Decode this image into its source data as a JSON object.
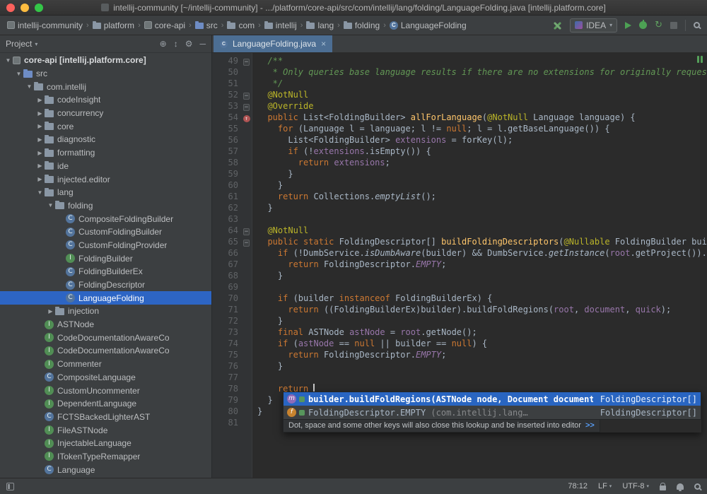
{
  "window": {
    "title": "intellij-community [~/intellij-community] - .../platform/core-api/src/com/intellij/lang/folding/LanguageFolding.java [intellij.platform.core]"
  },
  "navbar": {
    "crumbs": [
      {
        "label": "intellij-community",
        "icon": "project"
      },
      {
        "label": "platform",
        "icon": "folder"
      },
      {
        "label": "core-api",
        "icon": "module"
      },
      {
        "label": "src",
        "icon": "folder-src"
      },
      {
        "label": "com",
        "icon": "package"
      },
      {
        "label": "intellij",
        "icon": "package"
      },
      {
        "label": "lang",
        "icon": "package"
      },
      {
        "label": "folding",
        "icon": "package"
      },
      {
        "label": "LanguageFolding",
        "icon": "class"
      }
    ],
    "run_config": "IDEA"
  },
  "project_panel": {
    "title": "Project",
    "tree": [
      {
        "depth": 0,
        "label": "core-api [intellij.platform.core]",
        "icon": "module",
        "expand": "open",
        "bold": true
      },
      {
        "depth": 1,
        "label": "src",
        "icon": "folder-src",
        "expand": "open"
      },
      {
        "depth": 2,
        "label": "com.intellij",
        "icon": "package",
        "expand": "open"
      },
      {
        "depth": 3,
        "label": "codeInsight",
        "icon": "package",
        "expand": "closed"
      },
      {
        "depth": 3,
        "label": "concurrency",
        "icon": "package",
        "expand": "closed"
      },
      {
        "depth": 3,
        "label": "core",
        "icon": "package",
        "expand": "closed"
      },
      {
        "depth": 3,
        "label": "diagnostic",
        "icon": "package",
        "expand": "closed"
      },
      {
        "depth": 3,
        "label": "formatting",
        "icon": "package",
        "expand": "closed"
      },
      {
        "depth": 3,
        "label": "ide",
        "icon": "package",
        "expand": "closed"
      },
      {
        "depth": 3,
        "label": "injected.editor",
        "icon": "package",
        "expand": "closed"
      },
      {
        "depth": 3,
        "label": "lang",
        "icon": "package",
        "expand": "open"
      },
      {
        "depth": 4,
        "label": "folding",
        "icon": "package",
        "expand": "open"
      },
      {
        "depth": 5,
        "label": "CompositeFoldingBuilder",
        "icon": "class"
      },
      {
        "depth": 5,
        "label": "CustomFoldingBuilder",
        "icon": "class"
      },
      {
        "depth": 5,
        "label": "CustomFoldingProvider",
        "icon": "class"
      },
      {
        "depth": 5,
        "label": "FoldingBuilder",
        "icon": "interface"
      },
      {
        "depth": 5,
        "label": "FoldingBuilderEx",
        "icon": "class"
      },
      {
        "depth": 5,
        "label": "FoldingDescriptor",
        "icon": "class"
      },
      {
        "depth": 5,
        "label": "LanguageFolding",
        "icon": "class",
        "selected": true
      },
      {
        "depth": 4,
        "label": "injection",
        "icon": "package",
        "expand": "closed"
      },
      {
        "depth": 3,
        "label": "ASTNode",
        "icon": "interface"
      },
      {
        "depth": 3,
        "label": "CodeDocumentationAwareCo",
        "icon": "interface"
      },
      {
        "depth": 3,
        "label": "CodeDocumentationAwareCo",
        "icon": "interface"
      },
      {
        "depth": 3,
        "label": "Commenter",
        "icon": "interface"
      },
      {
        "depth": 3,
        "label": "CompositeLanguage",
        "icon": "class"
      },
      {
        "depth": 3,
        "label": "CustomUncommenter",
        "icon": "interface"
      },
      {
        "depth": 3,
        "label": "DependentLanguage",
        "icon": "interface"
      },
      {
        "depth": 3,
        "label": "FCTSBackedLighterAST",
        "icon": "class"
      },
      {
        "depth": 3,
        "label": "FileASTNode",
        "icon": "interface"
      },
      {
        "depth": 3,
        "label": "InjectableLanguage",
        "icon": "interface"
      },
      {
        "depth": 3,
        "label": "ITokenTypeRemapper",
        "icon": "interface"
      },
      {
        "depth": 3,
        "label": "Language",
        "icon": "class"
      }
    ]
  },
  "editor_tabs": [
    {
      "label": "LanguageFolding.java",
      "close": "×"
    }
  ],
  "editor": {
    "lines": [
      {
        "n": 49,
        "fold": "minus",
        "seg": [
          [
            "  /**",
            "c"
          ]
        ]
      },
      {
        "n": 50,
        "seg": [
          [
            "   * Only queries base language results if there are no extensions for originally requested",
            "c"
          ]
        ]
      },
      {
        "n": 51,
        "seg": [
          [
            "   */",
            "c"
          ]
        ]
      },
      {
        "n": 52,
        "fold": "minus",
        "seg": [
          [
            "  ",
            "d"
          ],
          [
            "@NotNull",
            "a"
          ]
        ]
      },
      {
        "n": 53,
        "fold": "minus",
        "seg": [
          [
            "  ",
            "d"
          ],
          [
            "@Override",
            "a"
          ]
        ]
      },
      {
        "n": 54,
        "gutter": "override",
        "seg": [
          [
            "  ",
            "d"
          ],
          [
            "public ",
            "k"
          ],
          [
            "List<FoldingBuilder> ",
            "d"
          ],
          [
            "allForLanguage",
            "m"
          ],
          [
            "(",
            "d"
          ],
          [
            "@NotNull",
            "a"
          ],
          [
            " Language language) {",
            "d"
          ]
        ]
      },
      {
        "n": 55,
        "seg": [
          [
            "    ",
            "d"
          ],
          [
            "for",
            "k"
          ],
          [
            " (Language l = language; l != ",
            "d"
          ],
          [
            "null",
            "k"
          ],
          [
            "; l = l.getBaseLanguage()) {",
            "d"
          ]
        ]
      },
      {
        "n": 56,
        "seg": [
          [
            "      List<FoldingBuilder> ",
            "d"
          ],
          [
            "extensions",
            "f"
          ],
          [
            " = forKey(l);",
            "d"
          ]
        ]
      },
      {
        "n": 57,
        "seg": [
          [
            "      ",
            "d"
          ],
          [
            "if",
            "k"
          ],
          [
            " (!",
            "d"
          ],
          [
            "extensions",
            "f"
          ],
          [
            ".isEmpty()) {",
            "d"
          ]
        ]
      },
      {
        "n": 58,
        "seg": [
          [
            "        ",
            "d"
          ],
          [
            "return ",
            "k"
          ],
          [
            "extensions",
            "f"
          ],
          [
            ";",
            "d"
          ]
        ]
      },
      {
        "n": 59,
        "seg": [
          [
            "      }",
            "d"
          ]
        ]
      },
      {
        "n": 60,
        "seg": [
          [
            "    }",
            "d"
          ]
        ]
      },
      {
        "n": 61,
        "seg": [
          [
            "    ",
            "d"
          ],
          [
            "return ",
            "k"
          ],
          [
            "Collections.",
            "d"
          ],
          [
            "emptyList",
            "si"
          ],
          [
            "();",
            "d"
          ]
        ]
      },
      {
        "n": 62,
        "seg": [
          [
            "  }",
            "d"
          ]
        ]
      },
      {
        "n": 63,
        "seg": []
      },
      {
        "n": 64,
        "fold": "minus",
        "seg": [
          [
            "  ",
            "d"
          ],
          [
            "@NotNull",
            "a"
          ]
        ]
      },
      {
        "n": 65,
        "fold": "minus",
        "seg": [
          [
            "  ",
            "d"
          ],
          [
            "public static ",
            "k"
          ],
          [
            "FoldingDescriptor[] ",
            "d"
          ],
          [
            "buildFoldingDescriptors",
            "m"
          ],
          [
            "(",
            "d"
          ],
          [
            "@Nullable",
            "a"
          ],
          [
            " FoldingBuilder builder",
            "d"
          ]
        ]
      },
      {
        "n": 66,
        "seg": [
          [
            "    ",
            "d"
          ],
          [
            "if",
            "k"
          ],
          [
            " (!DumbService.",
            "d"
          ],
          [
            "isDumbAware",
            "si"
          ],
          [
            "(builder) && DumbService.",
            "d"
          ],
          [
            "getInstance",
            "si"
          ],
          [
            "(",
            "d"
          ],
          [
            "root",
            "f"
          ],
          [
            ".getProject()).isDum",
            "d"
          ]
        ]
      },
      {
        "n": 67,
        "seg": [
          [
            "      ",
            "d"
          ],
          [
            "return ",
            "k"
          ],
          [
            "FoldingDescriptor.",
            "d"
          ],
          [
            "EMPTY",
            "sf"
          ],
          [
            ";",
            "d"
          ]
        ]
      },
      {
        "n": 68,
        "seg": [
          [
            "    }",
            "d"
          ]
        ]
      },
      {
        "n": 69,
        "seg": []
      },
      {
        "n": 70,
        "seg": [
          [
            "    ",
            "d"
          ],
          [
            "if",
            "k"
          ],
          [
            " (builder ",
            "d"
          ],
          [
            "instanceof",
            "k"
          ],
          [
            " FoldingBuilderEx) {",
            "d"
          ]
        ]
      },
      {
        "n": 71,
        "seg": [
          [
            "      ",
            "d"
          ],
          [
            "return ",
            "k"
          ],
          [
            "((FoldingBuilderEx)builder).buildFoldRegions(",
            "d"
          ],
          [
            "root",
            "f"
          ],
          [
            ", ",
            "d"
          ],
          [
            "document",
            "f"
          ],
          [
            ", ",
            "d"
          ],
          [
            "quick",
            "f"
          ],
          [
            ");",
            "d"
          ]
        ]
      },
      {
        "n": 72,
        "seg": [
          [
            "    }",
            "d"
          ]
        ]
      },
      {
        "n": 73,
        "seg": [
          [
            "    ",
            "d"
          ],
          [
            "final ",
            "k"
          ],
          [
            "ASTNode ",
            "d"
          ],
          [
            "astNode",
            "f"
          ],
          [
            " = ",
            "d"
          ],
          [
            "root",
            "f"
          ],
          [
            ".getNode();",
            "d"
          ]
        ]
      },
      {
        "n": 74,
        "seg": [
          [
            "    ",
            "d"
          ],
          [
            "if",
            "k"
          ],
          [
            " (",
            "d"
          ],
          [
            "astNode",
            "f"
          ],
          [
            " == ",
            "d"
          ],
          [
            "null",
            "k"
          ],
          [
            " || builder == ",
            "d"
          ],
          [
            "null",
            "k"
          ],
          [
            ") {",
            "d"
          ]
        ]
      },
      {
        "n": 75,
        "seg": [
          [
            "      ",
            "d"
          ],
          [
            "return ",
            "k"
          ],
          [
            "FoldingDescriptor.",
            "d"
          ],
          [
            "EMPTY",
            "sf"
          ],
          [
            ";",
            "d"
          ]
        ]
      },
      {
        "n": 76,
        "seg": [
          [
            "    }",
            "d"
          ]
        ]
      },
      {
        "n": 77,
        "seg": []
      },
      {
        "n": 78,
        "caret": true,
        "seg": [
          [
            "    ",
            "d"
          ],
          [
            "return ",
            "k"
          ]
        ]
      },
      {
        "n": 79,
        "seg": [
          [
            "  }",
            "d"
          ]
        ]
      },
      {
        "n": 80,
        "seg": [
          [
            "}",
            "d"
          ]
        ]
      },
      {
        "n": 81,
        "seg": []
      }
    ]
  },
  "popup": {
    "items": [
      {
        "icon": "method",
        "label": "builder.buildFoldRegions(ASTNode node, Document document)",
        "type": "FoldingDescriptor[]",
        "selected": true
      },
      {
        "icon": "field",
        "label": "FoldingDescriptor.EMPTY",
        "tail": " (com.intellij.lang…",
        "type": "FoldingDescriptor[]",
        "selected": false
      }
    ],
    "hint": "Dot, space and some other keys will also close this lookup and be inserted into editor",
    "hint_link": ">>"
  },
  "status_bar": {
    "position": "78:12",
    "line_sep": "LF",
    "encoding": "UTF-8"
  },
  "colors": {
    "editor_bg": "#2b2b2b",
    "panel_bg": "#3c3f41",
    "selection_blue": "#2d65c4",
    "popup_selection": "#2965c1",
    "keyword": "#cc7832",
    "annotation": "#bbb529",
    "comment": "#629755",
    "method_decl": "#ffc66b",
    "member_purple": "#9876aa",
    "text": "#a9b7c6",
    "line_number": "#606366",
    "active_tab": "#4c6e93",
    "interface_green": "#518e55",
    "class_blue": "#53749c"
  }
}
